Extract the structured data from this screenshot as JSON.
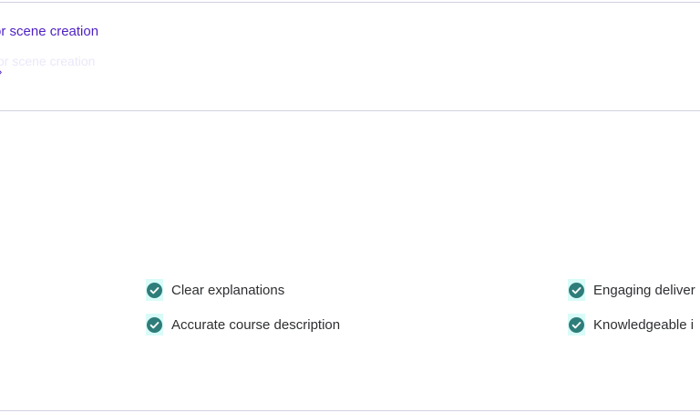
{
  "top_section": {
    "link_text": "or scene creation",
    "faded_text": "or scene creation",
    "chevron": "›"
  },
  "features": [
    {
      "label": "Clear explanations",
      "icon": "check-circle-icon"
    },
    {
      "label": "Accurate course description",
      "icon": "check-circle-icon"
    },
    {
      "label": "Engaging deliver",
      "icon": "check-circle-icon"
    },
    {
      "label": "Knowledgeable i",
      "icon": "check-circle-icon"
    }
  ],
  "colors": {
    "link": "#5022c3",
    "check_circle": "#2e7d7a",
    "check_bg": "#d9fbf8",
    "text": "#2d2f31",
    "divider": "#d1d2e0"
  }
}
